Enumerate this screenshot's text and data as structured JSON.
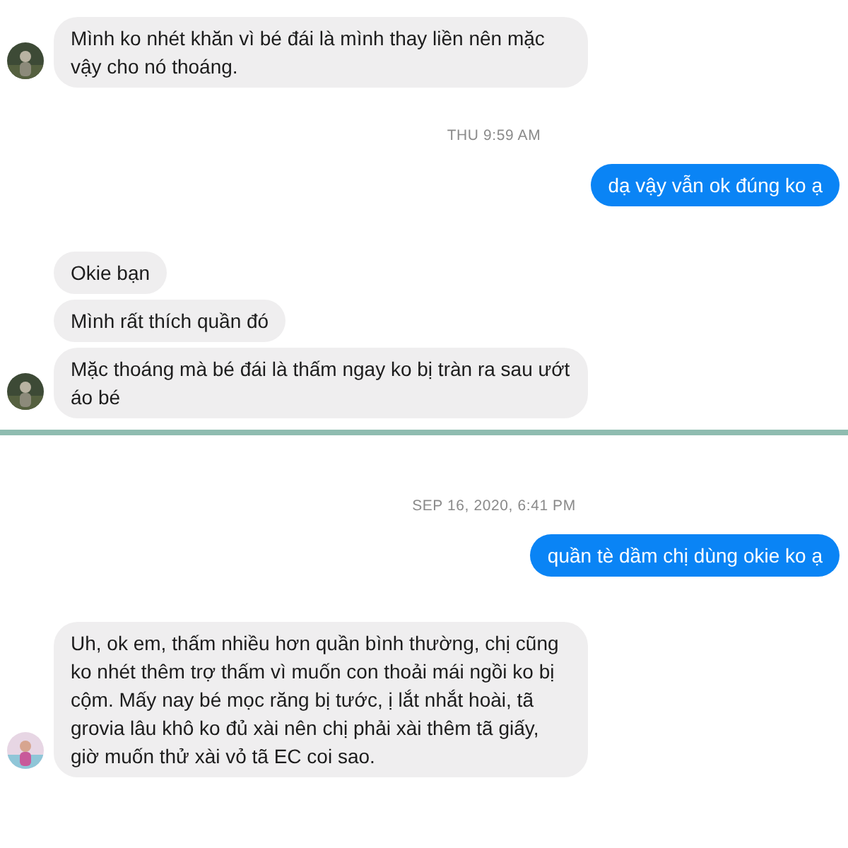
{
  "sections": [
    {
      "items": [
        {
          "kind": "incoming",
          "avatar": true,
          "text": "Mình ko nhét khăn vì bé đái là mình thay liền nên mặc vậy cho nó thoáng."
        },
        {
          "kind": "timestamp",
          "text": "THU 9:59 AM"
        },
        {
          "kind": "outgoing",
          "text": "dạ vậy vẫn ok đúng ko ạ"
        },
        {
          "kind": "incoming",
          "avatar": false,
          "text": "Okie bạn"
        },
        {
          "kind": "incoming",
          "avatar": false,
          "text": "Mình rất thích quần đó"
        },
        {
          "kind": "incoming",
          "avatar": true,
          "text": "Mặc thoáng mà bé đái là thấm ngay ko bị tràn ra sau ướt áo bé"
        }
      ]
    },
    {
      "items": [
        {
          "kind": "timestamp",
          "text": "SEP 16, 2020, 6:41 PM"
        },
        {
          "kind": "outgoing",
          "text": "quần tè dầm chị dùng okie ko ạ"
        },
        {
          "kind": "incoming",
          "avatar": true,
          "text": "Uh, ok em, thấm nhiều hơn quần bình thường, chị cũng ko nhét thêm trợ thấm vì muốn con thoải mái ngồi ko bị cộm. Mấy nay bé mọc răng bị tước, ị lắt nhắt hoài, tã grovia lâu khô ko đủ xài nên chị phải xài thêm tã giấy, giờ muốn thử xài vỏ tã EC coi sao."
        }
      ]
    }
  ]
}
